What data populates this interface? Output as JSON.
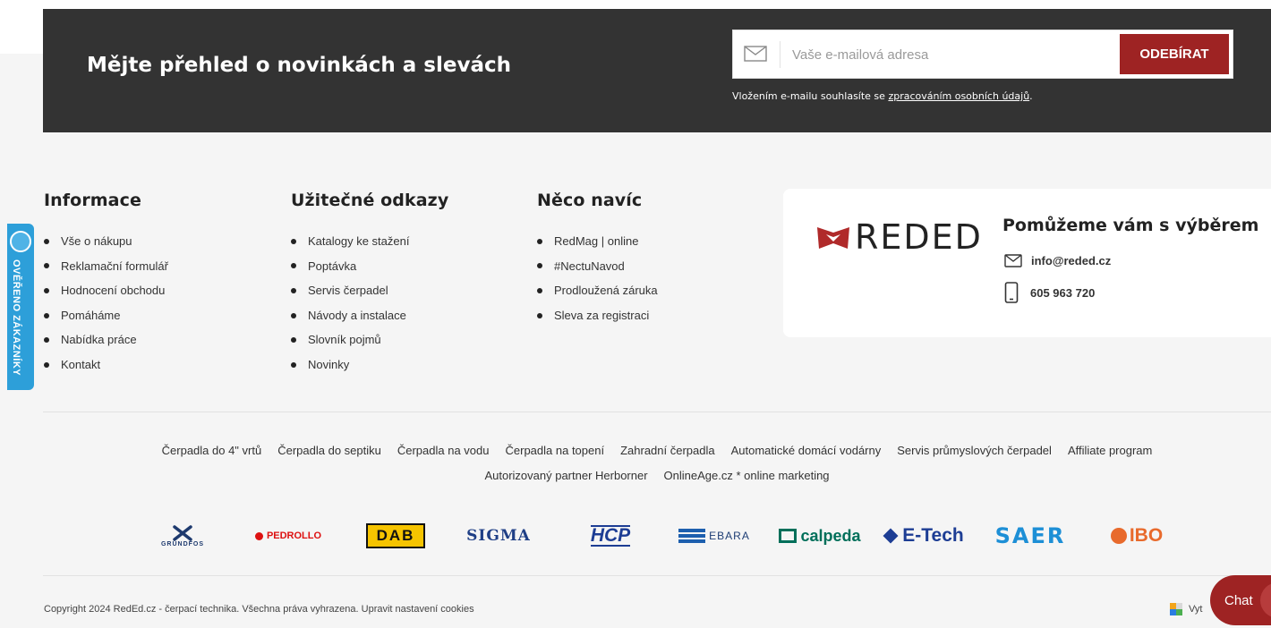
{
  "newsletter": {
    "title": "Mějte přehled o novinkách a slevách",
    "placeholder": "Vaše e-mailová adresa",
    "button": "ODEBÍRAT",
    "consent_prefix": "Vložením e-mailu souhlasíte se ",
    "consent_link": "zpracováním osobních údajů",
    "consent_suffix": "."
  },
  "columns": [
    {
      "title": "Informace",
      "items": [
        "Vše o nákupu",
        "Reklamační formulář",
        "Hodnocení obchodu",
        "Pomáháme",
        "Nabídka práce",
        "Kontakt"
      ]
    },
    {
      "title": "Užitečné odkazy",
      "items": [
        "Katalogy ke stažení",
        "Poptávka",
        "Servis čerpadel",
        "Návody a instalace",
        "Slovník pojmů",
        "Novinky"
      ]
    },
    {
      "title": "Něco navíc",
      "items": [
        "RedMag | online",
        "#NectuNavod",
        "Prodloužená záruka",
        "Sleva za registraci"
      ]
    }
  ],
  "contact": {
    "logo": "REDED",
    "title": "Pomůžeme vám s výběrem",
    "email": "info@reded.cz",
    "phone": "605 963 720"
  },
  "seo_links": [
    "Čerpadla do 4\" vrtů",
    "Čerpadla do septiku",
    "Čerpadla na vodu",
    "Čerpadla na topení",
    "Zahradní čerpadla",
    "Automatické domácí vodárny",
    "Servis průmyslových čerpadel",
    "Affiliate program",
    "Autorizovaný partner Herborner",
    "OnlineAge.cz * online marketing"
  ],
  "brands": [
    "GRUNDFOS",
    "PEDROLLO",
    "DAB",
    "SIGMA",
    "HCP",
    "EBARA",
    "calpeda",
    "E-Tech",
    "SAER",
    "IBO"
  ],
  "copyright": "Copyright 2024 RedEd.cz - čerpací technika. Všechna práva vyhrazena. Upravit nastavení cookies",
  "verified_badge": "OVĚŘENO ZÁKAZNÍKY",
  "chat_label": "Chat",
  "widget_label": "Vyt",
  "colors": {
    "dark": "#333333",
    "accent": "#9e2323",
    "badge": "#2d9fd9"
  }
}
